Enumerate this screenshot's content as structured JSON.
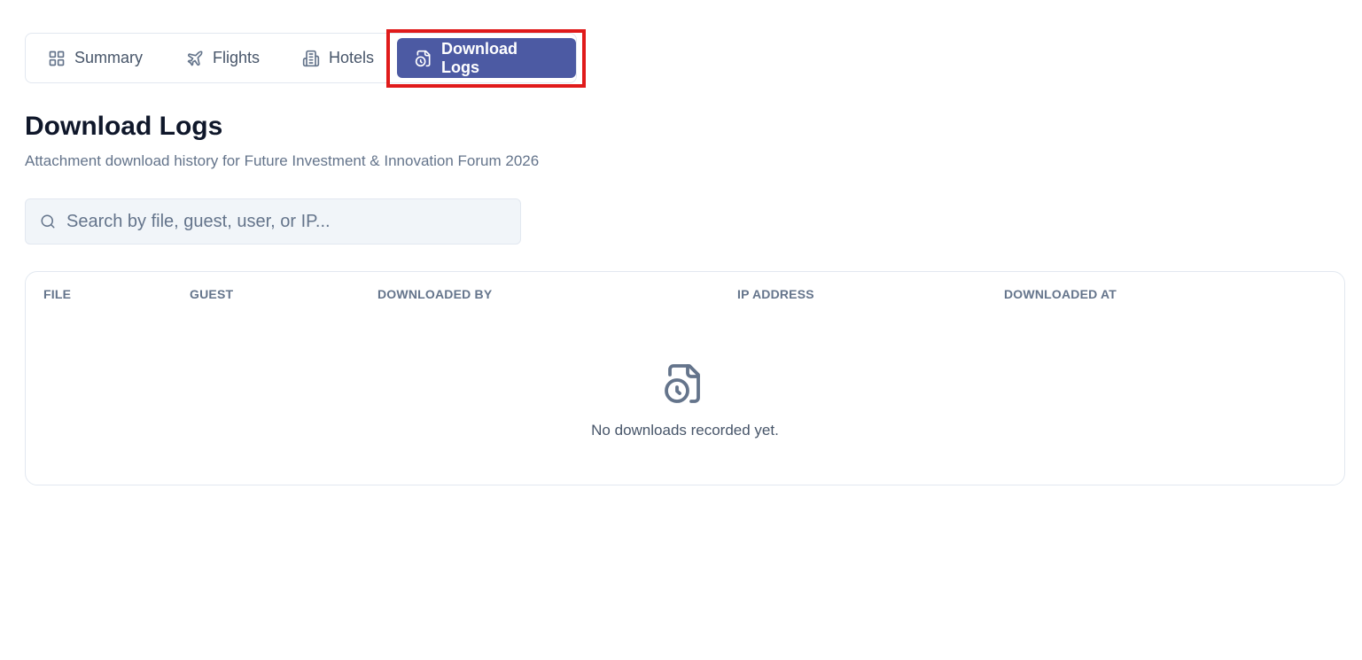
{
  "tabs": [
    {
      "label": "Summary",
      "icon": "grid-icon"
    },
    {
      "label": "Flights",
      "icon": "plane-icon"
    },
    {
      "label": "Hotels",
      "icon": "building-icon"
    },
    {
      "label": "Download Logs",
      "icon": "file-clock-icon",
      "active": true
    }
  ],
  "page": {
    "title": "Download Logs",
    "subtitle": "Attachment download history for Future Investment & Innovation Forum 2026"
  },
  "search": {
    "placeholder": "Search by file, guest, user, or IP...",
    "value": ""
  },
  "table": {
    "columns": [
      "FILE",
      "GUEST",
      "DOWNLOADED BY",
      "IP ADDRESS",
      "DOWNLOADED AT"
    ],
    "rows": [],
    "empty_message": "No downloads recorded yet."
  },
  "colors": {
    "accent": "#4c5aa3",
    "highlight": "#e01b1b",
    "muted_text": "#64748b",
    "border": "#e2e8f0"
  }
}
